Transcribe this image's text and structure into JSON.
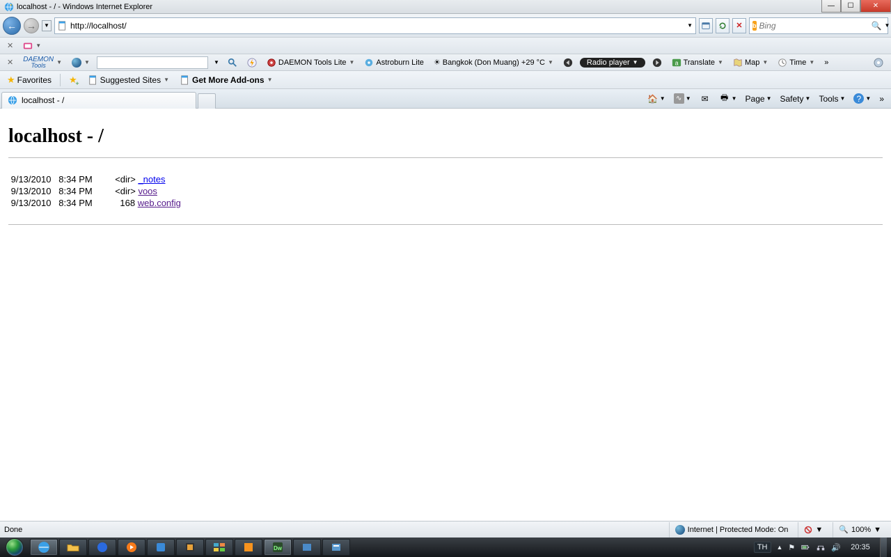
{
  "window": {
    "title": "localhost - / - Windows Internet Explorer"
  },
  "address": {
    "url": "http://localhost/"
  },
  "search": {
    "engine": "Bing",
    "placeholder": "Bing"
  },
  "daemon_row": {
    "brand_line1": "DAEMON",
    "brand_line2": "Tools",
    "items": {
      "dtools": "DAEMON Tools Lite",
      "astroburn": "Astroburn Lite",
      "weather": "Bangkok (Don Muang) +29 °C",
      "radio": "Radio player",
      "translate": "Translate",
      "map": "Map",
      "time": "Time"
    }
  },
  "favorites": {
    "label": "Favorites",
    "suggested": "Suggested Sites",
    "addons": "Get More Add-ons"
  },
  "tab": {
    "title": "localhost - /"
  },
  "cmd": {
    "page": "Page",
    "safety": "Safety",
    "tools": "Tools"
  },
  "page": {
    "heading": "localhost - /",
    "entries": [
      {
        "date": "9/13/2010",
        "time": "8:34 PM",
        "size": "<dir>",
        "name": "_notes",
        "link_class": "blue"
      },
      {
        "date": "9/13/2010",
        "time": "8:34 PM",
        "size": "<dir>",
        "name": "voos",
        "link_class": ""
      },
      {
        "date": "9/13/2010",
        "time": "8:34 PM",
        "size": "168",
        "name": "web.config",
        "link_class": ""
      }
    ]
  },
  "status": {
    "left": "Done",
    "zone": "Internet | Protected Mode: On",
    "zoom": "100%"
  },
  "tray": {
    "lang": "TH",
    "clock": "20:35"
  }
}
